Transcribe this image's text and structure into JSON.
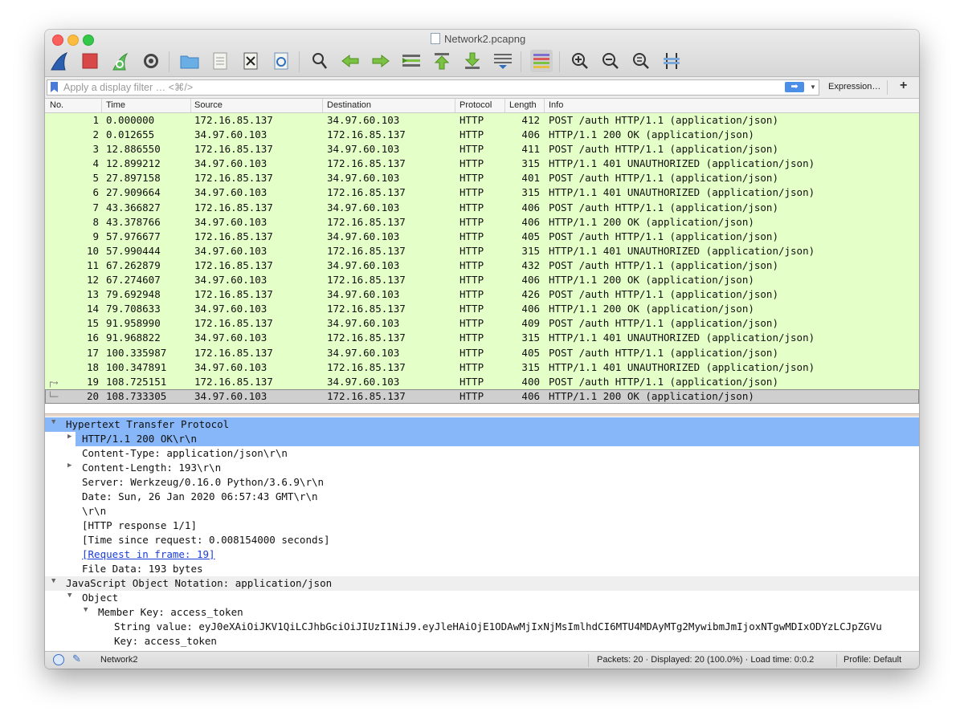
{
  "window": {
    "title": "Network2.pcapng"
  },
  "filter": {
    "placeholder": "Apply a display filter … <⌘/>",
    "expression_label": "Expression…",
    "plus_label": "+"
  },
  "columns": {
    "no": "No.",
    "time": "Time",
    "source": "Source",
    "destination": "Destination",
    "protocol": "Protocol",
    "length": "Length",
    "info": "Info"
  },
  "packets": [
    {
      "no": "1",
      "time": "0.000000",
      "src": "172.16.85.137",
      "dst": "34.97.60.103",
      "proto": "HTTP",
      "len": "412",
      "info": "POST /auth HTTP/1.1  (application/json)"
    },
    {
      "no": "2",
      "time": "0.012655",
      "src": "34.97.60.103",
      "dst": "172.16.85.137",
      "proto": "HTTP",
      "len": "406",
      "info": "HTTP/1.1 200 OK  (application/json)"
    },
    {
      "no": "3",
      "time": "12.886550",
      "src": "172.16.85.137",
      "dst": "34.97.60.103",
      "proto": "HTTP",
      "len": "411",
      "info": "POST /auth HTTP/1.1  (application/json)"
    },
    {
      "no": "4",
      "time": "12.899212",
      "src": "34.97.60.103",
      "dst": "172.16.85.137",
      "proto": "HTTP",
      "len": "315",
      "info": "HTTP/1.1 401 UNAUTHORIZED  (application/json)"
    },
    {
      "no": "5",
      "time": "27.897158",
      "src": "172.16.85.137",
      "dst": "34.97.60.103",
      "proto": "HTTP",
      "len": "401",
      "info": "POST /auth HTTP/1.1  (application/json)"
    },
    {
      "no": "6",
      "time": "27.909664",
      "src": "34.97.60.103",
      "dst": "172.16.85.137",
      "proto": "HTTP",
      "len": "315",
      "info": "HTTP/1.1 401 UNAUTHORIZED  (application/json)"
    },
    {
      "no": "7",
      "time": "43.366827",
      "src": "172.16.85.137",
      "dst": "34.97.60.103",
      "proto": "HTTP",
      "len": "406",
      "info": "POST /auth HTTP/1.1  (application/json)"
    },
    {
      "no": "8",
      "time": "43.378766",
      "src": "34.97.60.103",
      "dst": "172.16.85.137",
      "proto": "HTTP",
      "len": "406",
      "info": "HTTP/1.1 200 OK  (application/json)"
    },
    {
      "no": "9",
      "time": "57.976677",
      "src": "172.16.85.137",
      "dst": "34.97.60.103",
      "proto": "HTTP",
      "len": "405",
      "info": "POST /auth HTTP/1.1  (application/json)"
    },
    {
      "no": "10",
      "time": "57.990444",
      "src": "34.97.60.103",
      "dst": "172.16.85.137",
      "proto": "HTTP",
      "len": "315",
      "info": "HTTP/1.1 401 UNAUTHORIZED  (application/json)"
    },
    {
      "no": "11",
      "time": "67.262879",
      "src": "172.16.85.137",
      "dst": "34.97.60.103",
      "proto": "HTTP",
      "len": "432",
      "info": "POST /auth HTTP/1.1  (application/json)"
    },
    {
      "no": "12",
      "time": "67.274607",
      "src": "34.97.60.103",
      "dst": "172.16.85.137",
      "proto": "HTTP",
      "len": "406",
      "info": "HTTP/1.1 200 OK  (application/json)"
    },
    {
      "no": "13",
      "time": "79.692948",
      "src": "172.16.85.137",
      "dst": "34.97.60.103",
      "proto": "HTTP",
      "len": "426",
      "info": "POST /auth HTTP/1.1  (application/json)"
    },
    {
      "no": "14",
      "time": "79.708633",
      "src": "34.97.60.103",
      "dst": "172.16.85.137",
      "proto": "HTTP",
      "len": "406",
      "info": "HTTP/1.1 200 OK  (application/json)"
    },
    {
      "no": "15",
      "time": "91.958990",
      "src": "172.16.85.137",
      "dst": "34.97.60.103",
      "proto": "HTTP",
      "len": "409",
      "info": "POST /auth HTTP/1.1  (application/json)"
    },
    {
      "no": "16",
      "time": "91.968822",
      "src": "34.97.60.103",
      "dst": "172.16.85.137",
      "proto": "HTTP",
      "len": "315",
      "info": "HTTP/1.1 401 UNAUTHORIZED  (application/json)"
    },
    {
      "no": "17",
      "time": "100.335987",
      "src": "172.16.85.137",
      "dst": "34.97.60.103",
      "proto": "HTTP",
      "len": "405",
      "info": "POST /auth HTTP/1.1  (application/json)"
    },
    {
      "no": "18",
      "time": "100.347891",
      "src": "34.97.60.103",
      "dst": "172.16.85.137",
      "proto": "HTTP",
      "len": "315",
      "info": "HTTP/1.1 401 UNAUTHORIZED  (application/json)"
    },
    {
      "no": "19",
      "time": "108.725151",
      "src": "172.16.85.137",
      "dst": "34.97.60.103",
      "proto": "HTTP",
      "len": "400",
      "info": "POST /auth HTTP/1.1  (application/json)"
    },
    {
      "no": "20",
      "time": "108.733305",
      "src": "34.97.60.103",
      "dst": "172.16.85.137",
      "proto": "HTTP",
      "len": "406",
      "info": "HTTP/1.1 200 OK  (application/json)"
    }
  ],
  "selected_packet": "20",
  "details": {
    "http_header": "Hypertext Transfer Protocol",
    "status_line": "HTTP/1.1 200 OK\\r\\n",
    "content_type": "Content-Type: application/json\\r\\n",
    "content_length": "Content-Length: 193\\r\\n",
    "server": "Server: Werkzeug/0.16.0 Python/3.6.9\\r\\n",
    "date": "Date: Sun, 26 Jan 2020 06:57:43 GMT\\r\\n",
    "crlf": "\\r\\n",
    "http_response": "[HTTP response 1/1]",
    "time_since": "[Time since request: 0.008154000 seconds]",
    "request_in_frame": "[Request in frame: 19]",
    "file_data": "File Data: 193 bytes",
    "json_header": "JavaScript Object Notation: application/json",
    "object": "Object",
    "member_key": "Member Key: access_token",
    "string_value": "String value: eyJ0eXAiOiJKV1QiLCJhbGciOiJIUzI1NiJ9.eyJleHAiOjE1ODAwMjIxNjMsImlhdCI6MTU4MDAyMTg2MywibmJmIjoxNTgwMDIxODYzLCJpZGVu",
    "key": "Key: access_token"
  },
  "status": {
    "profile_name": "Network2",
    "packets_summary": "Packets: 20 · Displayed: 20 (100.0%) · Load time: 0:0.2",
    "profile": "Profile: Default"
  },
  "toolbar_icons": [
    "shark-fin-icon",
    "stop-icon",
    "restart-icon",
    "options-gear-icon",
    "open-folder-icon",
    "save-file-icon",
    "close-file-icon",
    "reload-icon",
    "find-icon",
    "back-arrow-icon",
    "forward-arrow-icon",
    "go-to-packet-icon",
    "first-packet-icon",
    "last-packet-icon",
    "autoscroll-icon",
    "colorize-icon",
    "zoom-in-icon",
    "zoom-out-icon",
    "zoom-normal-icon",
    "resize-columns-icon"
  ]
}
